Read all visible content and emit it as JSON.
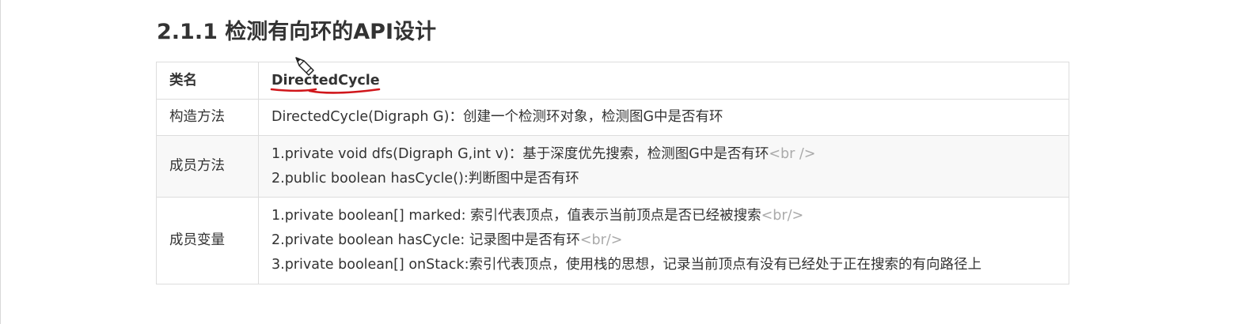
{
  "heading": "2.1.1 检测有向环的API设计",
  "table": {
    "class_row": {
      "key": "类名",
      "value": "DirectedCycle"
    },
    "constructor_row": {
      "key": "构造方法",
      "value": "DirectedCycle(Digraph G)：创建一个检测环对象，检测图G中是否有环"
    },
    "methods_row": {
      "key": "成员方法",
      "lines": [
        {
          "text": "1.private void dfs(Digraph G,int v)：基于深度优先搜索，检测图G中是否有环",
          "tag": "<br />"
        },
        {
          "text": "2.public boolean hasCycle():判断图中是否有环",
          "tag": ""
        }
      ]
    },
    "fields_row": {
      "key": "成员变量",
      "lines": [
        {
          "text": "1.private boolean[] marked: 索引代表顶点，值表示当前顶点是否已经被搜索",
          "tag": "<br/>"
        },
        {
          "text": "2.private boolean hasCycle: 记录图中是否有环",
          "tag": "<br/>"
        },
        {
          "text": "3.private boolean[] onStack:索引代表顶点，使用栈的思想，记录当前顶点有没有已经处于正在搜索的有向路径上",
          "tag": ""
        }
      ]
    }
  },
  "annotation": {
    "color": "#d0161b",
    "icon": "pencil-cursor-icon"
  }
}
